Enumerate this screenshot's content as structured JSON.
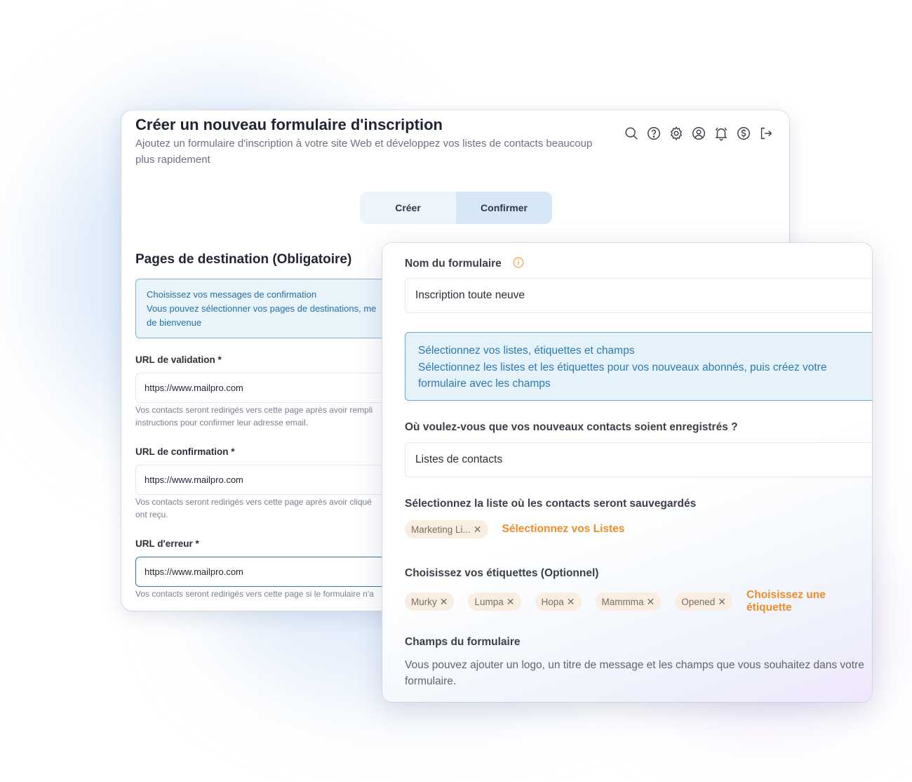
{
  "back": {
    "title": "Créer un nouveau formulaire d'inscription",
    "subtitle": "Ajoutez un formulaire d'inscription à votre site Web et développez vos listes de contacts beaucoup plus rapidement",
    "icons": [
      "search-icon",
      "help-icon",
      "settings-icon",
      "user-icon",
      "bell-icon",
      "dollar-icon",
      "logout-icon"
    ],
    "steps": [
      {
        "label": "Créer",
        "active": false
      },
      {
        "label": "Confirmer",
        "active": true
      }
    ],
    "section_title": "Pages de destination (Obligatoire)",
    "info": {
      "line1": "Choisissez vos messages de confirmation",
      "line2": "Vous pouvez sélectionner vos pages de destinations, me",
      "line3": "de bienvenue"
    },
    "fields": [
      {
        "label": "URL de validation *",
        "value": "https://www.mailpro.com",
        "help1": "Vos contacts seront redirigés vers cette page après avoir rempli",
        "help2": "instructions pour confirmer leur adresse email."
      },
      {
        "label": "URL de confirmation *",
        "value": "https://www.mailpro.com",
        "help1": "Vos contacts seront redirigés vers cette page après avoir cliqué",
        "help2": "ont reçu."
      },
      {
        "label": "URL d'erreur *",
        "value": "https://www.mailpro.com",
        "help1": "Vos contacts seront redirigés vers cette page si le formulaire n'a",
        "help2": ""
      }
    ]
  },
  "front": {
    "form_name_label": "Nom du formulaire",
    "form_name_value": "Inscription toute neuve",
    "info_title": "Sélectionnez vos listes, étiquettes et champs",
    "info_body": "Sélectionnez les listes et les étiquettes pour vos nouveaux abonnés, puis créez votre formulaire avec les champs",
    "save_where_label": "Où voulez-vous que vos nouveaux contacts soient enregistrés ?",
    "save_where_value": "Listes de contacts",
    "list_label": "Sélectionnez la liste où les contacts seront sauvegardés",
    "list_chips": [
      "Marketing Li..."
    ],
    "list_link": "Sélectionnez vos Listes",
    "tags_label": "Choisissez vos étiquettes (Optionnel)",
    "tag_chips": [
      "Murky",
      "Lumpa",
      "Hopa",
      "Mammma",
      "Opened"
    ],
    "tags_link": "Choisissez une étiquette",
    "fields_label": "Champs du formulaire",
    "fields_text": "Vous pouvez ajouter un logo, un titre de message et les champs que vous souhaitez dans votre formulaire.",
    "remove_symbol": "✕"
  },
  "colors": {
    "accent_orange": "#f08c27",
    "info_blue": "#2b7ab5",
    "chip_bg": "#faeee2"
  }
}
